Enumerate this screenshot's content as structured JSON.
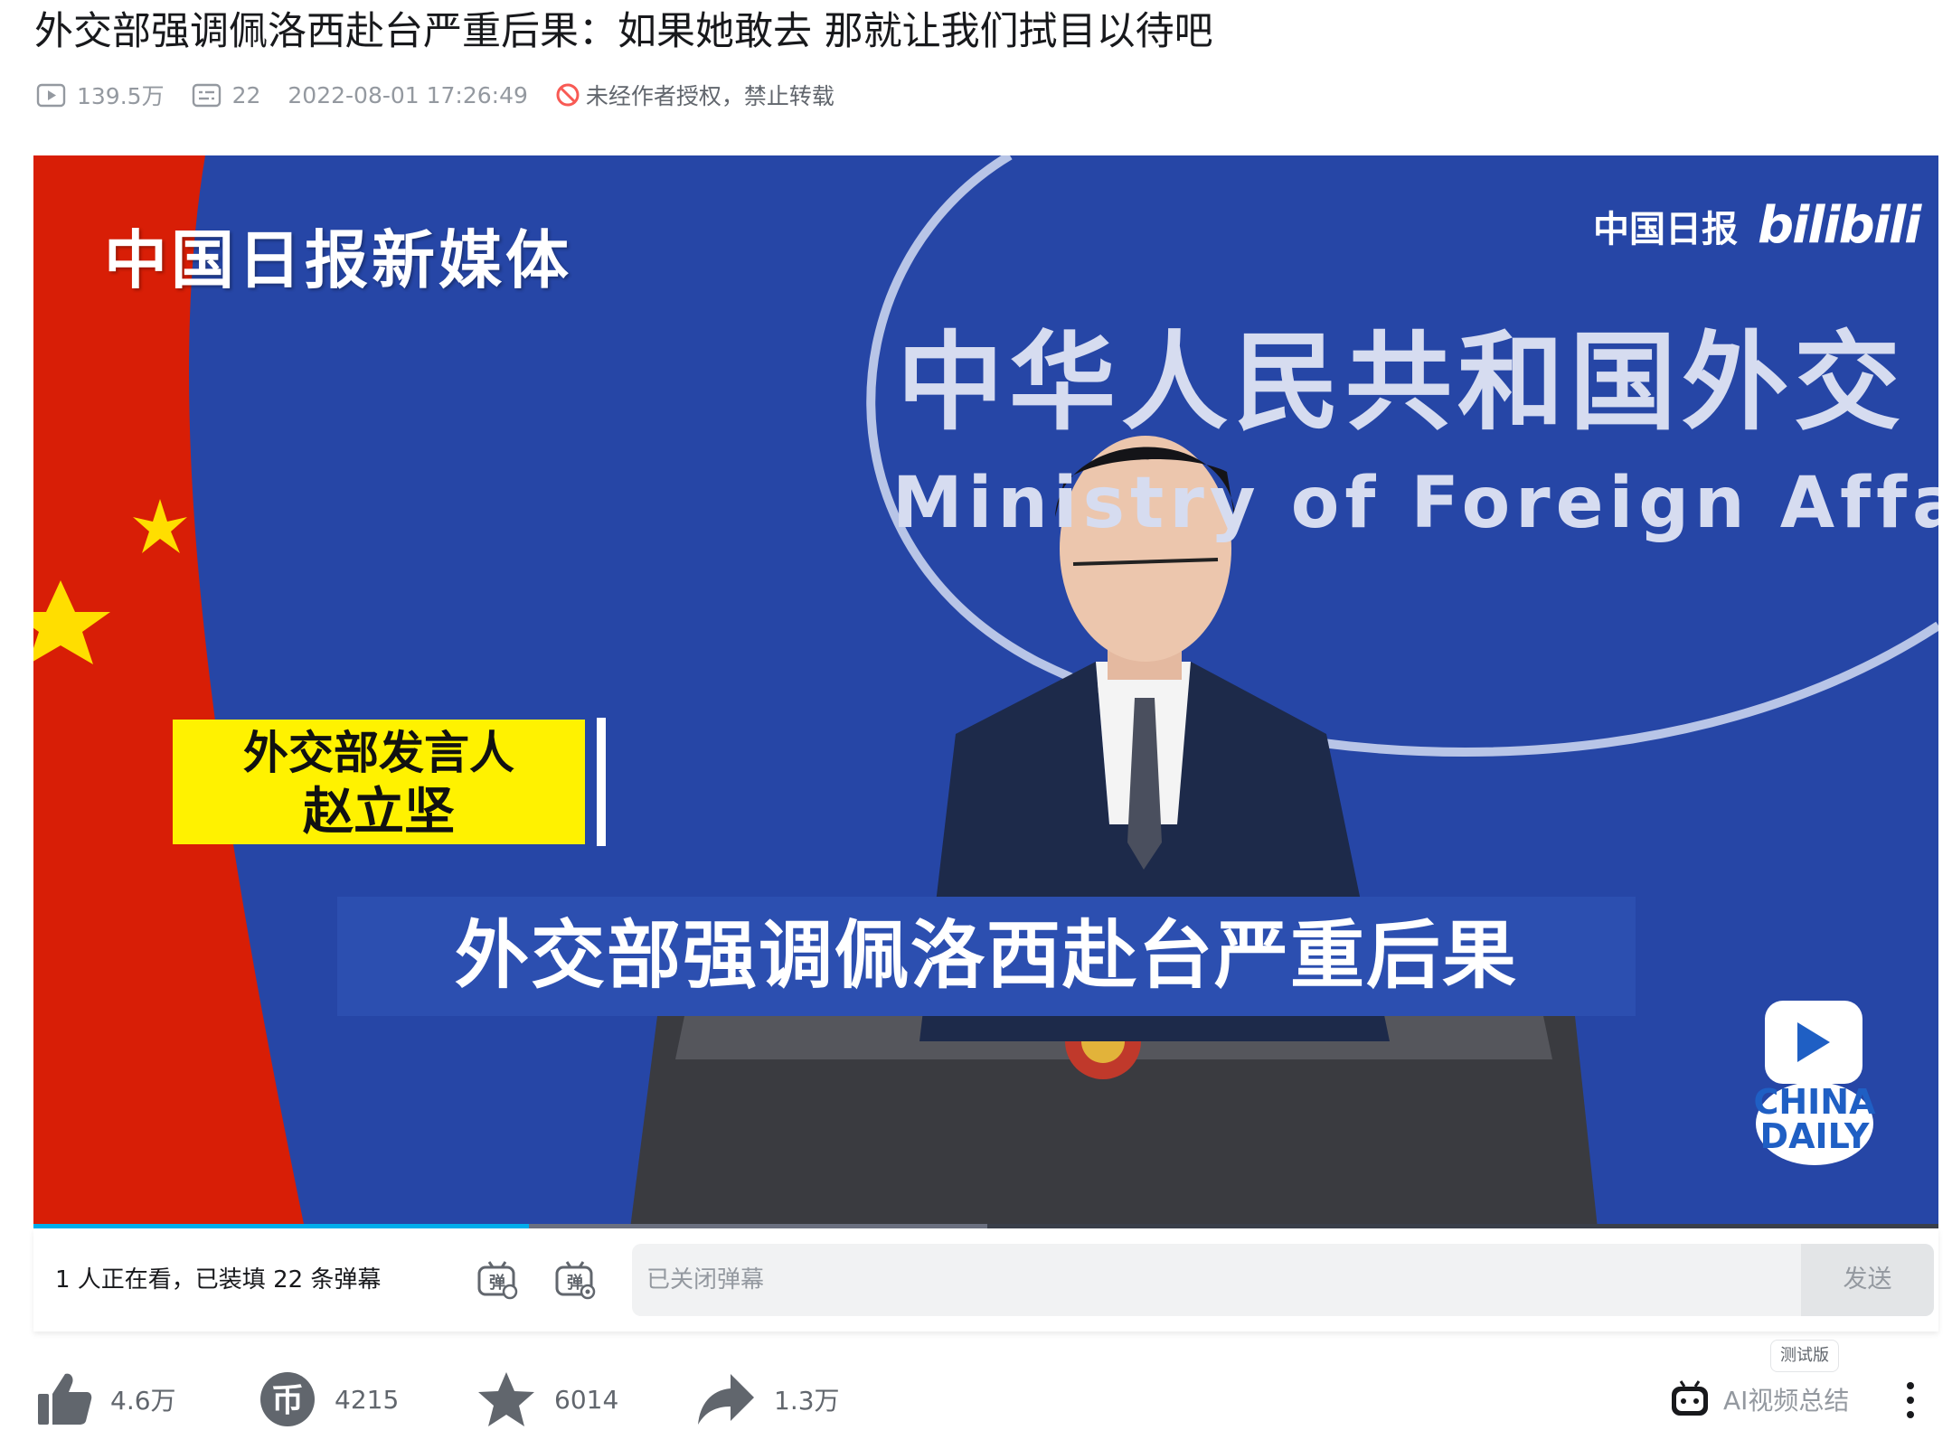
{
  "video": {
    "title": "外交部强调佩洛西赴台严重后果：如果她敢去 那就让我们拭目以待吧",
    "views": "139.5万",
    "danmaku_count": "22",
    "publish_time": "2022-08-01 17:26:49",
    "copyright_notice": "未经作者授权，禁止转载"
  },
  "frame": {
    "watermark_brand": "中国日报新媒体",
    "corner_logo_text": "中国日报",
    "corner_logo_brand": "bilibili",
    "backdrop_cn": "中华人民共和国外交",
    "backdrop_en": "Ministry of Foreign Affa",
    "speaker_caption_line1": "外交部发言人",
    "speaker_caption_line2": "赵立坚",
    "subtitle": "外交部强调佩洛西赴台严重后果",
    "china_daily_line1": "CHINA",
    "china_daily_line2": "DAILY",
    "progress_fraction": 0.26
  },
  "danmaku": {
    "viewers_text": "1 人正在看，已装填 22 条弹幕",
    "input_placeholder": "已关闭弹幕",
    "send_label": "发送"
  },
  "actions": {
    "like": "4.6万",
    "coin": "4215",
    "favorite": "6014",
    "share": "1.3万",
    "ai_summary": "AI视频总结",
    "ai_badge": "测试版"
  },
  "colors": {
    "accent": "#00aeec",
    "backdrop_blue": "#2646a6",
    "caption_yellow": "#fff200",
    "subtitle_band": "#2c4fb0",
    "flag_red": "#d81e06"
  }
}
